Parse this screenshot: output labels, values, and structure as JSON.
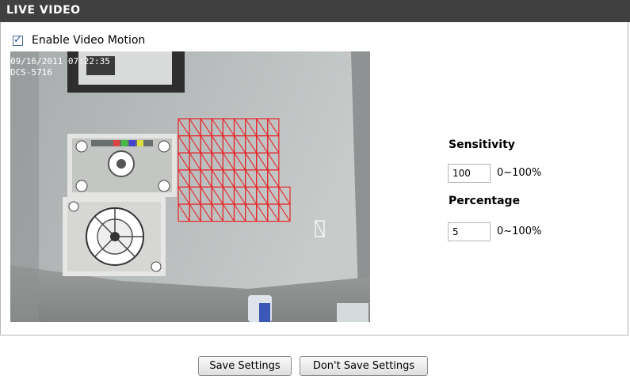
{
  "header": {
    "title": "LIVE VIDEO"
  },
  "motion": {
    "enable_label": "Enable Video Motion",
    "enabled": true
  },
  "video": {
    "overlay_line1": "09/16/2011 07:22:35",
    "overlay_line2": "DCS-5716"
  },
  "sensitivity": {
    "label": "Sensitivity",
    "value": "100",
    "range": "0~100%"
  },
  "percentage": {
    "label": "Percentage",
    "value": "5",
    "range": "0~100%"
  },
  "buttons": {
    "save": "Save Settings",
    "dont_save": "Don't Save Settings"
  },
  "colors": {
    "header_bg": "#404040",
    "grid": "#e8262a"
  }
}
